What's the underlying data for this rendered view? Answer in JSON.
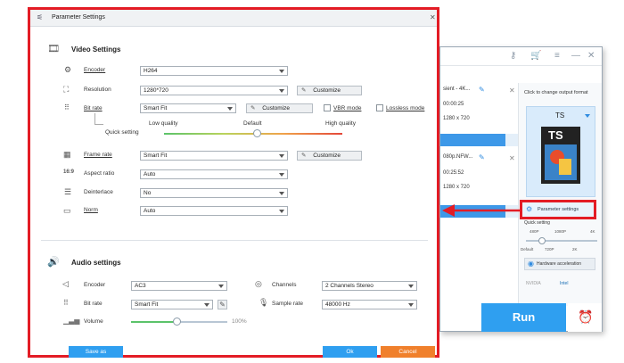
{
  "dialog": {
    "title": "Parameter Settings",
    "video_section_title": "Video Settings",
    "audio_section_title": "Audio settings",
    "video": {
      "encoder": {
        "label": "Encoder",
        "value": "H264"
      },
      "resolution": {
        "label": "Resolution",
        "value": "1280*720",
        "customize": "Customize"
      },
      "bitrate": {
        "label": "Bit rate",
        "value": "Smart Fit",
        "customize": "Customize",
        "vbr_label": "VBR mode",
        "lossless_label": "Lossless mode"
      },
      "quality": {
        "low": "Low quality",
        "default": "Default",
        "high": "High quality",
        "label": "Quick setting",
        "level": 0.52
      },
      "framerate": {
        "label": "Frame rate",
        "value": "Smart Fit",
        "customize": "Customize"
      },
      "aspect": {
        "label": "Aspect ratio",
        "value": "Auto"
      },
      "deinterlace": {
        "label": "Deinterlace",
        "value": "No"
      },
      "norm": {
        "label": "Norm",
        "value": "Auto"
      }
    },
    "audio": {
      "encoder": {
        "label": "Encoder",
        "value": "AC3"
      },
      "channels": {
        "label": "Channels",
        "value": "2 Channels Stereo"
      },
      "bitrate": {
        "label": "Bit rate",
        "value": "Smart Fit"
      },
      "samplerate": {
        "label": "Sample rate",
        "value": "48000 Hz"
      },
      "volume": {
        "label": "Volume",
        "value": "100%",
        "level": 0.47
      }
    },
    "footer": {
      "save_as": "Save as",
      "ok": "Ok",
      "cancel": "Cancel"
    }
  },
  "app": {
    "items": [
      {
        "name": "sient - 4K...",
        "duration": "00:00:25",
        "res": "1280 x 720"
      },
      {
        "name": "080p.NFW...",
        "duration": "00:25:52",
        "res": "1280 x 720"
      }
    ],
    "output_header": "Click to change output format",
    "format": "TS",
    "format_badge": "TS",
    "param_settings": "Parameter settings",
    "quick_setting": "Quick setting",
    "scale_top": [
      "480P",
      "1080P",
      "4K"
    ],
    "scale_bottom": [
      "Default",
      "720P",
      "2K"
    ],
    "hw_accel": "Hardware acceleration",
    "nvidia": "NVIDIA",
    "intel": "Intel",
    "run": "Run"
  },
  "colors": {
    "accent": "#2f9ff0",
    "highlight": "#e31c25",
    "cancel": "#f0802c"
  }
}
